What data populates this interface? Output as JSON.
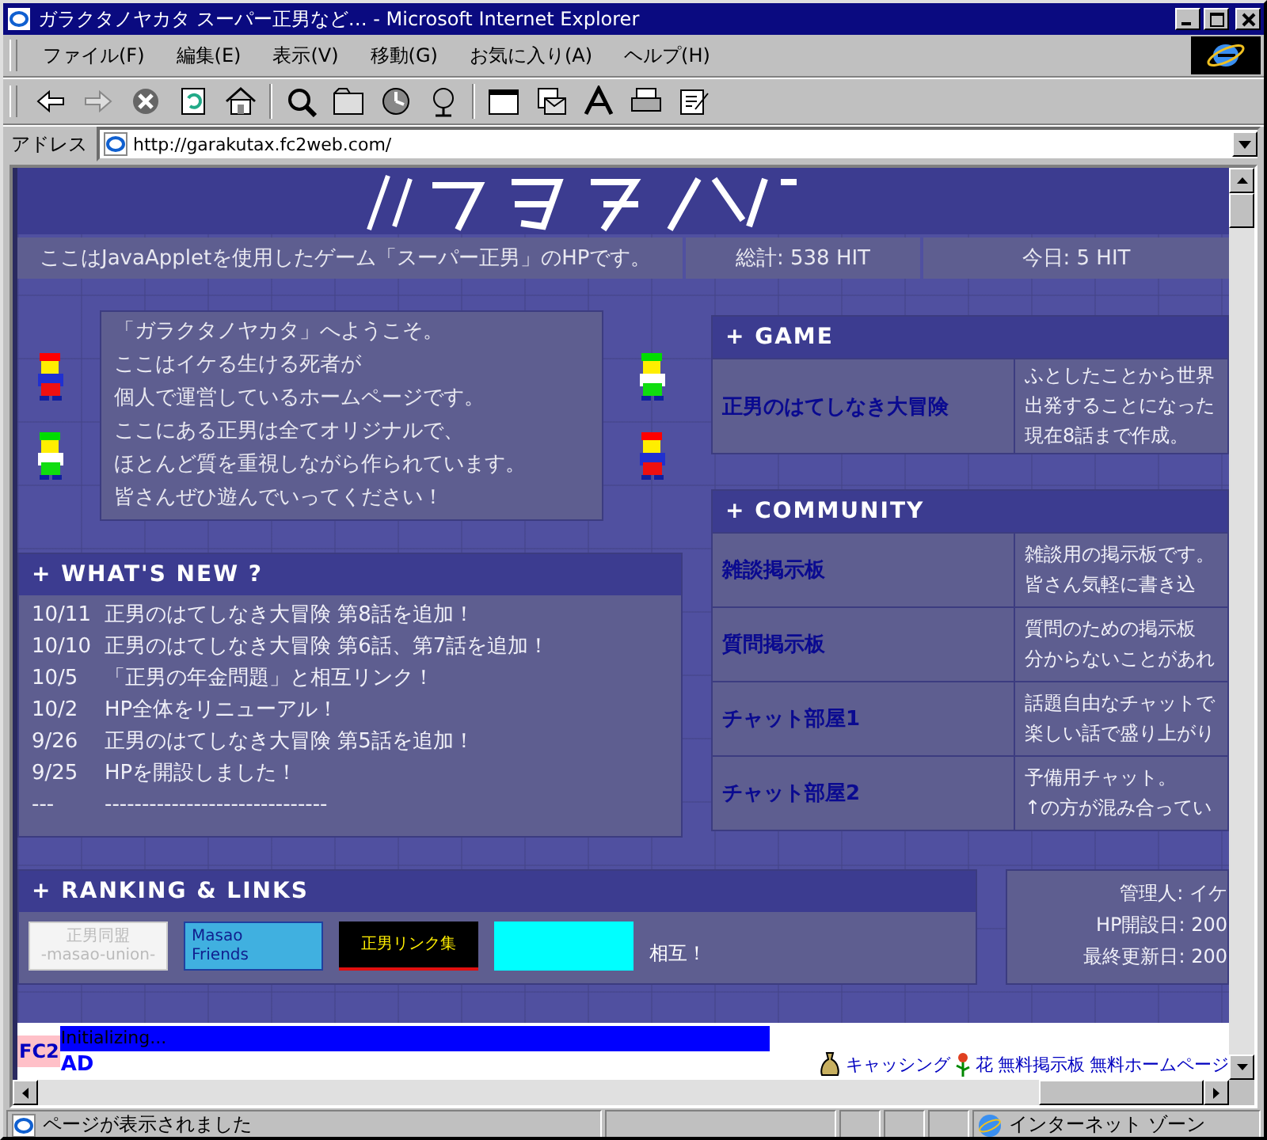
{
  "window": {
    "title": "ガラクタノヤカタ  スーパー正男など… - Microsoft Internet Explorer"
  },
  "menu": [
    "ファイル(F)",
    "編集(E)",
    "表示(V)",
    "移動(G)",
    "お気に入り(A)",
    "ヘルプ(H)"
  ],
  "address": {
    "label": "アドレス",
    "url": "http://garakutax.fc2web.com/"
  },
  "info_bar": [
    "ここはJavaAppletを使用したゲーム「スーパー正男」のHPです。",
    "総計: 538 HIT",
    "今日: 5 HIT"
  ],
  "sprites_left": [
    {
      "color": "#ff0000"
    },
    {
      "color": "#00dd00"
    }
  ],
  "sprites_right": [
    {
      "color": "#00dd00"
    },
    {
      "color": "#ff0000"
    }
  ],
  "welcome": [
    "「ガラクタノヤカタ」へようこそ。",
    "ここはイケる生ける死者が",
    "個人で運営しているホームページです。",
    "ここにある正男は全てオリジナルで、",
    "ほとんど質を重視しながら作られています。",
    "皆さんぜひ遊んでいってください！"
  ],
  "news": {
    "title": "+ WHAT'S NEW ?",
    "items": [
      {
        "date": "10/11",
        "text": "正男のはてしなき大冒険 第8話を追加！"
      },
      {
        "date": "10/10",
        "text": "正男のはてしなき大冒険 第6話、第7話を追加！"
      },
      {
        "date": "10/5",
        "text": "「正男の年金問題」と相互リンク！"
      },
      {
        "date": "10/2",
        "text": "HP全体をリニューアル！"
      },
      {
        "date": "9/26",
        "text": "正男のはてしなき大冒険 第5話を追加！"
      },
      {
        "date": "9/25",
        "text": "HPを開設しました！"
      },
      {
        "date": "---",
        "text": "------------------------------"
      }
    ]
  },
  "game": {
    "title": "+ GAME",
    "rows": [
      {
        "name": "正男のはてしなき大冒険",
        "desc": [
          "ふとしたことから世界",
          "出発することになった",
          "現在8話まで作成。"
        ]
      }
    ]
  },
  "community": {
    "title": "+ COMMUNITY",
    "rows": [
      {
        "name": "雑談掲示板",
        "desc": [
          "雑談用の掲示板です。",
          "皆さん気軽に書き込"
        ]
      },
      {
        "name": "質問掲示板",
        "desc": [
          "質問のための掲示板",
          "分からないことがあれ"
        ]
      },
      {
        "name": "チャット部屋1",
        "desc": [
          "話題自由なチャットで",
          "楽しい話で盛り上がり"
        ]
      },
      {
        "name": "チャット部屋2",
        "desc": [
          "予備用チャット。",
          "↑の方が混み合ってい"
        ]
      }
    ]
  },
  "links": {
    "title": "+ RANKING & LINKS",
    "banners": [
      {
        "kind": "union",
        "lines": [
          "正男同盟",
          "-masao-union-"
        ]
      },
      {
        "kind": "friends",
        "lines": [
          "Masao",
          "Friends"
        ]
      },
      {
        "kind": "linkshu",
        "lines": [
          "正男リンク集"
        ]
      },
      {
        "kind": "blank"
      }
    ],
    "note": "相互！"
  },
  "admin": [
    "管理人: イケ",
    "HP開設日: 200",
    "最終更新日: 200"
  ],
  "ad": {
    "logo": "FC2",
    "progress": "Initializing...",
    "label": "AD",
    "links": [
      "キャッシング",
      "花",
      "無料掲示板",
      "無料ホームページ"
    ]
  },
  "status": {
    "text": "ページが表示されました",
    "zone": "インターネット ゾーン"
  }
}
